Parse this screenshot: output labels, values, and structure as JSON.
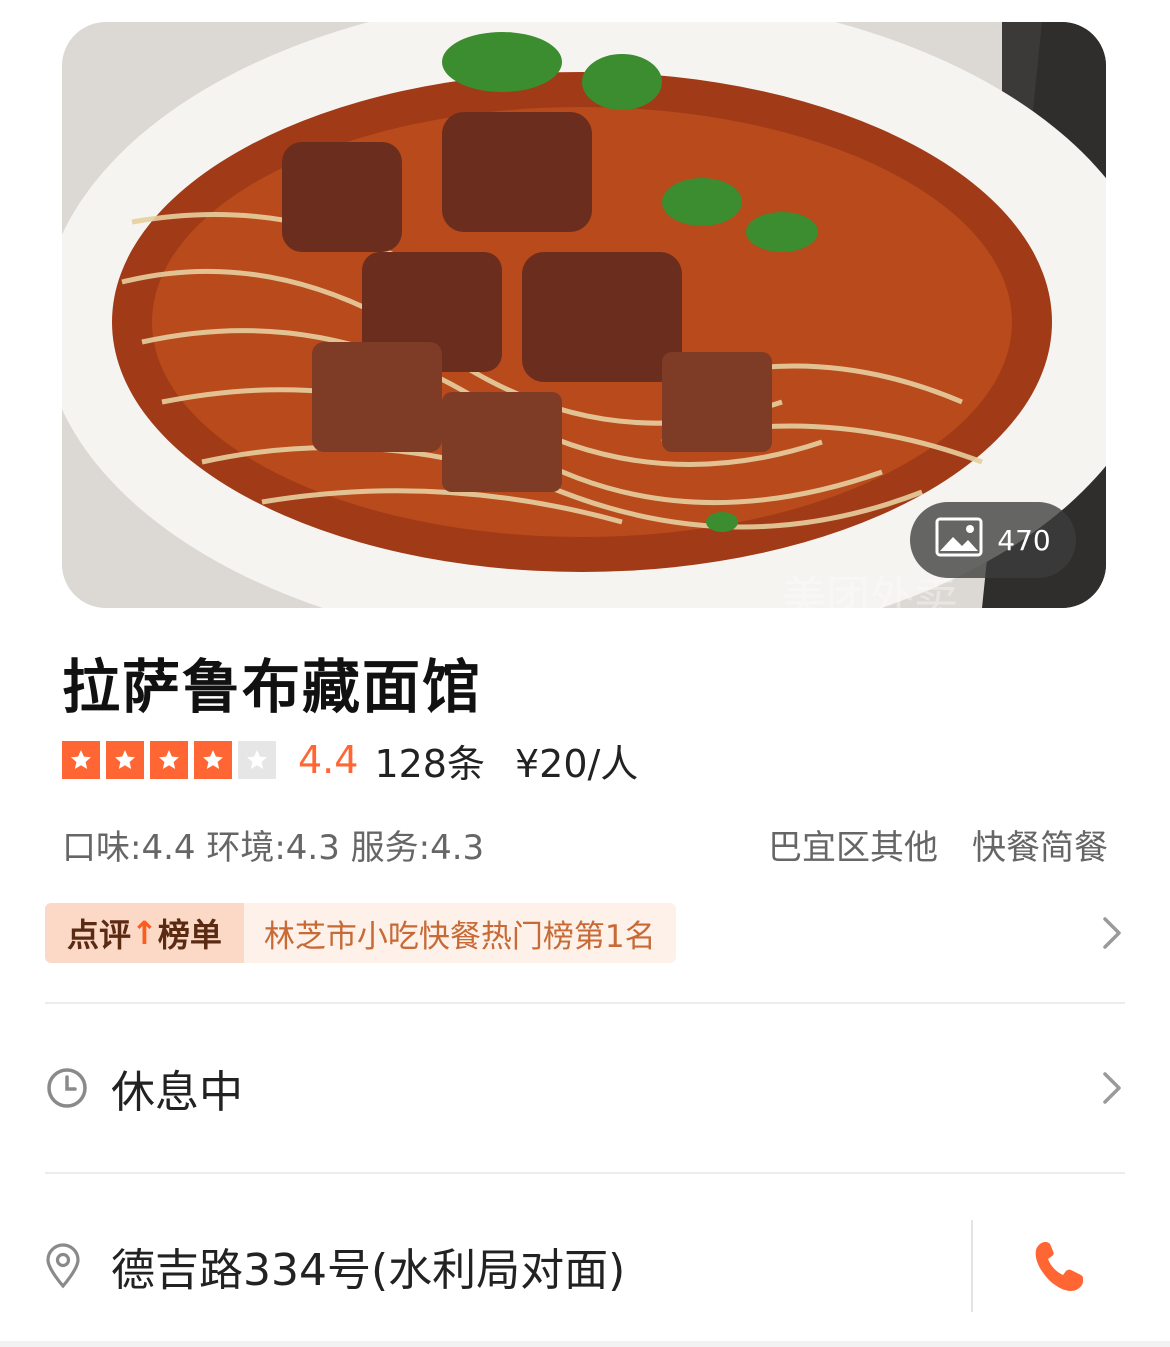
{
  "hero": {
    "photo_count": "470",
    "icon": "image-icon"
  },
  "shop": {
    "name": "拉萨鲁布藏面馆",
    "rating_stars": 4,
    "rating_max": 5,
    "score": "4.4",
    "reviews": "128条",
    "price": "¥20/人",
    "sub_scores": "口味:4.4 环境:4.3 服务:4.3",
    "area": "巴宜区其他",
    "category": "快餐简餐"
  },
  "ranking": {
    "label_left": "点评",
    "label_arrow": "↑",
    "label_right": "榜单",
    "text": "林芝市小吃快餐热门榜第1名"
  },
  "hours": {
    "status": "休息中",
    "icon": "clock-icon"
  },
  "address": {
    "text": "德吉路334号(水利局对面)",
    "icon": "location-pin-icon",
    "action_icon": "phone-icon"
  },
  "colors": {
    "accent": "#ff6633",
    "rank_bg": "#fdf1e9",
    "rank_label_bg": "#fbd9c6"
  }
}
